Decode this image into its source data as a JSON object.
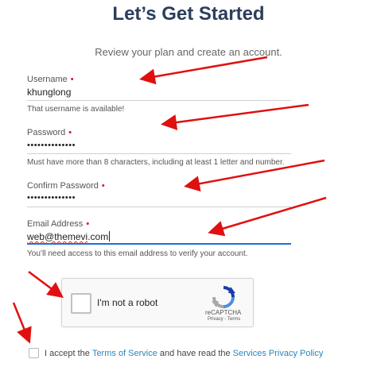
{
  "page": {
    "title": "Let’s Get Started",
    "subtitle": "Review your plan and create an account."
  },
  "form": {
    "username": {
      "label": "Username",
      "required_marker": "•",
      "value": "khunglong",
      "hint": "That username is available!"
    },
    "password": {
      "label": "Password",
      "required_marker": "•",
      "value": "••••••••••••••",
      "hint": "Must have more than 8 characters, including at least 1 letter and number."
    },
    "confirm_password": {
      "label": "Confirm Password",
      "required_marker": "•",
      "value": "••••••••••••••"
    },
    "email": {
      "label": "Email Address",
      "required_marker": "•",
      "value_name": "web@themevi",
      "value_domain": ".com",
      "hint": "You’ll need access to this email address to verify your account."
    }
  },
  "captcha": {
    "label": "I'm not a robot",
    "brand": "reCAPTCHA",
    "links": "Privacy - Terms"
  },
  "terms": {
    "prefix": "I accept the",
    "tos_link": "Terms of Service",
    "middle": "and have read the",
    "privacy_link": "Services Privacy Policy"
  },
  "colors": {
    "title": "#2c3e5c",
    "required": "#e0002a",
    "link": "#2a86b8",
    "annotation_arrow": "#e01010",
    "active_field": "#1e6fd9"
  }
}
